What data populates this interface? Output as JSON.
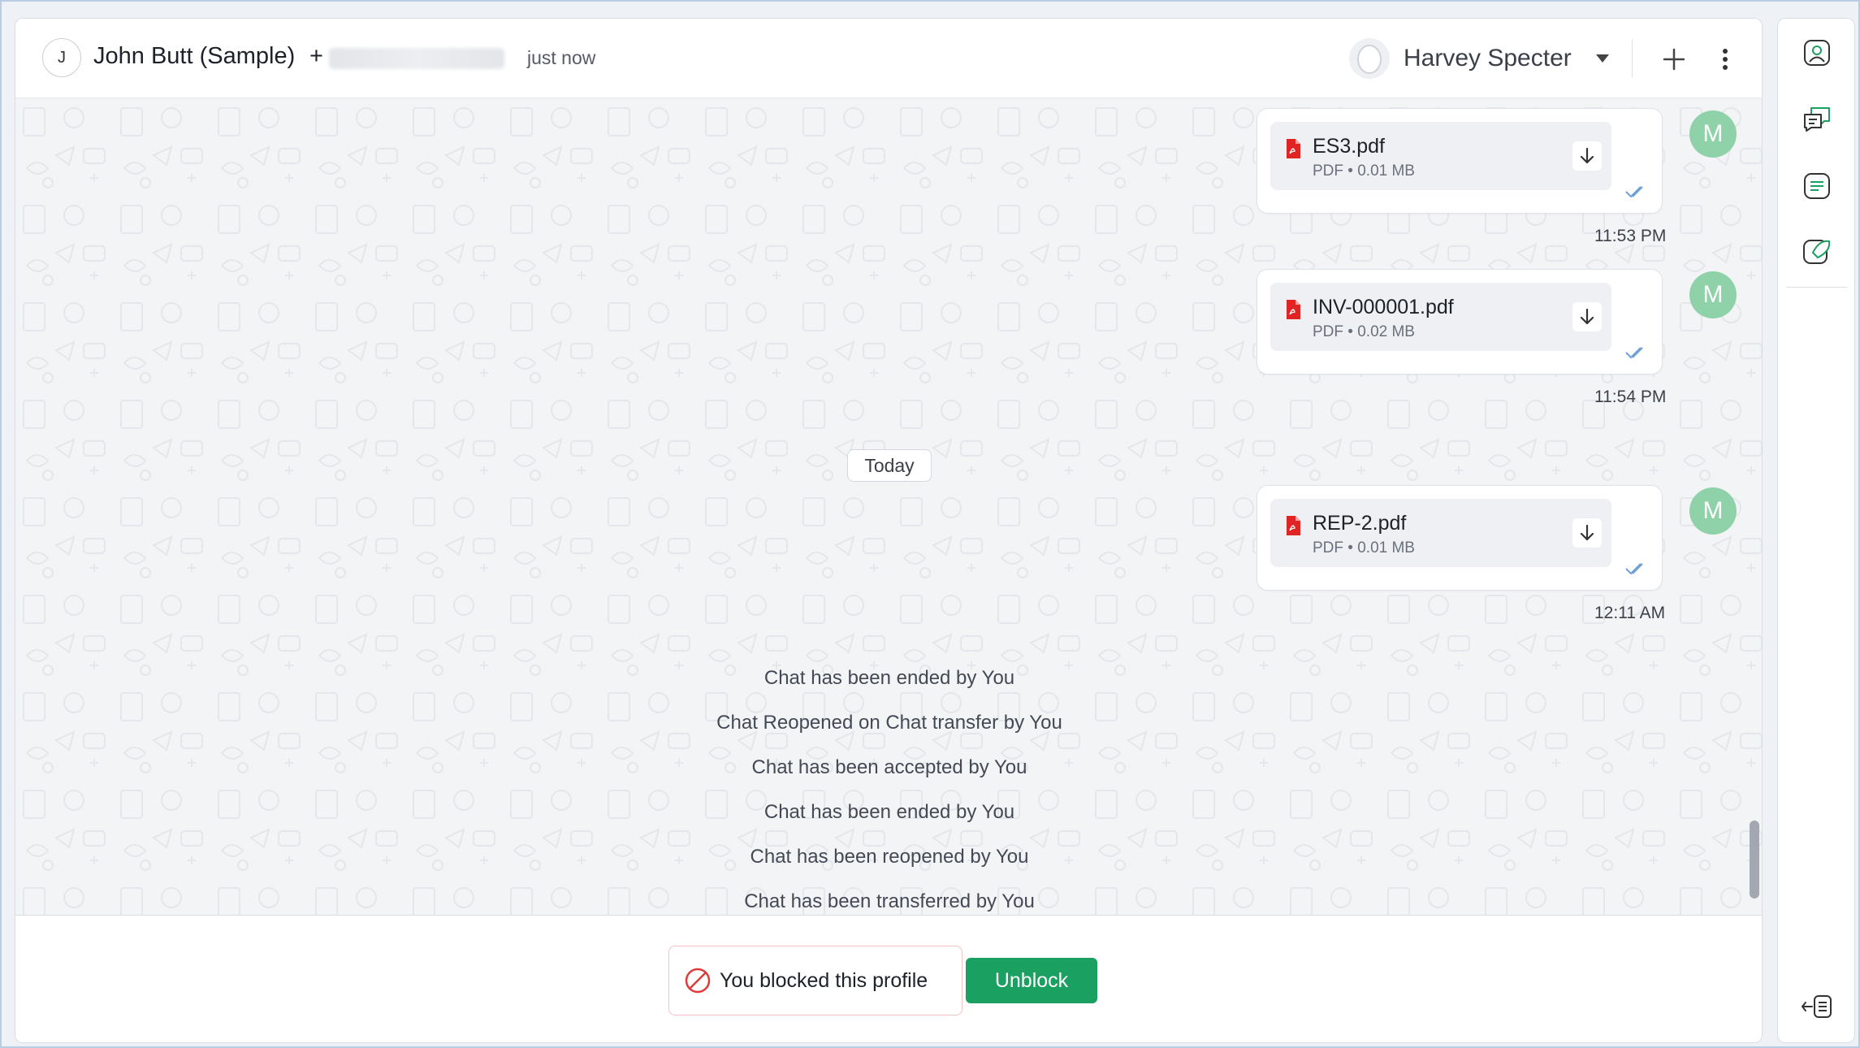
{
  "header": {
    "contact_initial": "J",
    "contact_name": "John Butt (Sample)",
    "contact_phone_prefix": "+",
    "last_seen": "just now",
    "agent_name": "Harvey Specter"
  },
  "messages": [
    {
      "file_name": "ES3.pdf",
      "file_type": "PDF",
      "file_size": "0.01 MB",
      "time": "11:53 PM",
      "sender_initial": "M"
    },
    {
      "file_name": "INV-000001.pdf",
      "file_type": "PDF",
      "file_size": "0.02 MB",
      "time": "11:54 PM",
      "sender_initial": "M"
    },
    {
      "file_name": "REP-2.pdf",
      "file_type": "PDF",
      "file_size": "0.01 MB",
      "time": "12:11 AM",
      "sender_initial": "M"
    }
  ],
  "day_separator": "Today",
  "meta_sep": "•",
  "events": [
    "Chat has been ended by You",
    "Chat Reopened on Chat transfer by You",
    "Chat has been accepted by You",
    "Chat has been ended by You",
    "Chat has been reopened by You",
    "Chat has been transferred by You"
  ],
  "footer": {
    "blocked_text": "You blocked this profile",
    "unblock_label": "Unblock"
  },
  "colors": {
    "accent_green": "#1aa060",
    "avatar_green": "#8fd1a8",
    "pdf_red": "#e02424",
    "tick_blue": "#6f9fd8",
    "block_red": "#e03a3a"
  },
  "icons": {
    "rail": [
      "contact-profile-icon",
      "conversations-icon",
      "notes-icon",
      "tag-icon",
      "collapse-panel-icon"
    ]
  }
}
